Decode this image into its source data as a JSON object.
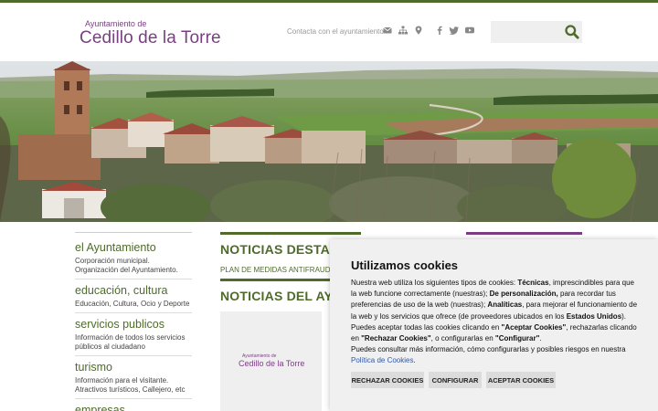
{
  "header": {
    "logo_sub": "Ayuntamiento de",
    "logo_main": "Cedillo de la Torre",
    "contact_label": "Contacta con el ayuntamiento",
    "icons": [
      "envelope-icon",
      "sitemap-icon",
      "map-pin-icon",
      "facebook-icon",
      "twitter-icon",
      "youtube-icon"
    ],
    "search_placeholder": ""
  },
  "sidebar": {
    "items": [
      {
        "title": "el Ayuntamiento",
        "desc": "Corporación municipal. Organización del Ayuntamiento."
      },
      {
        "title": "educación, cultura",
        "desc": "Educación, Cultura, Ocio y Deporte"
      },
      {
        "title": "servicios publicos",
        "desc": "Información de todos los servicios públicos al ciudadano"
      },
      {
        "title": "turismo",
        "desc": "Información para el visitante. Atractivos turísticos, Callejero, etc"
      },
      {
        "title": "empresas",
        "desc": ""
      }
    ]
  },
  "main": {
    "featured_title": "NOTICIAS DESTACADAS",
    "featured_link": "PLAN DE MEDIDAS ANTIFRAUDE",
    "news_title": "NOTICIAS DEL AYUNTAMIENTO",
    "card_logo_sub": "Ayuntamiento de",
    "card_logo_main": "Cedillo de la Torre"
  },
  "cookies": {
    "title": "Utilizamos cookies",
    "p1_a": "Nuestra web utiliza los siguientes tipos de cookies: ",
    "p1_b": "Técnicas",
    "p1_c": ", imprescindibles para que la web funcione correctamente (nuestras); ",
    "p1_d": "De personalización,",
    "p1_e": " para recordar tus preferencias de uso de la web (nuestras); ",
    "p1_f": "Analíticas",
    "p1_g": ", para mejorar el funcionamiento de la web y los servicios que ofrece (de proveedores ubicados en los ",
    "p1_h": "Estados Unidos",
    "p1_i": ").",
    "p2_a": "Puedes aceptar todas las cookies clicando en ",
    "p2_b": "\"Aceptar Cookies\"",
    "p2_c": ", rechazarlas clicando en ",
    "p2_d": "\"Rechazar Cookies\"",
    "p2_e": ", o configurarlas en ",
    "p2_f": "\"Configurar\"",
    "p2_g": ".",
    "p3_a": "Puedes consultar más información, cómo configurarlas y posibles riesgos en nuestra ",
    "p3_link": "Política de Cookies",
    "p3_b": ".",
    "btn_reject": "RECHAZAR COOKIES",
    "btn_config": "CONFIGURAR",
    "btn_accept": "ACEPTAR COOKIES"
  },
  "colors": {
    "brand_green": "#4e6b2a",
    "brand_purple": "#7a3f83",
    "link_blue": "#2e59a8"
  }
}
